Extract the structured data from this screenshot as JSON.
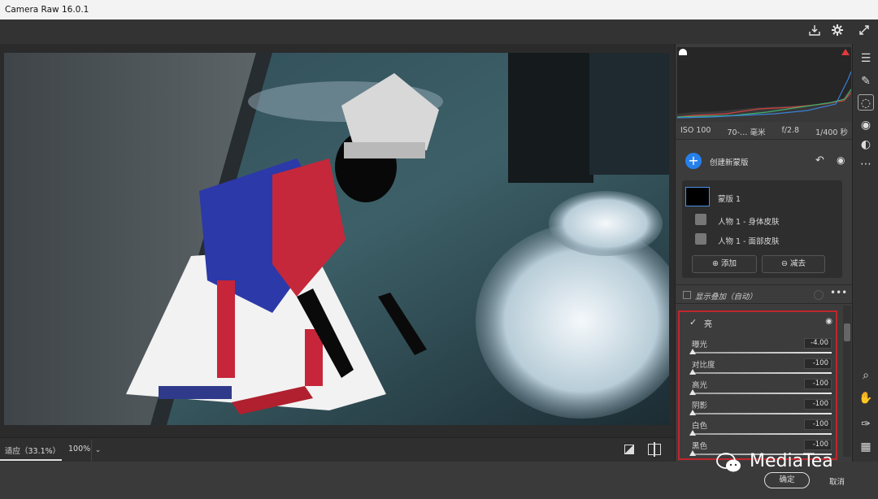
{
  "app": {
    "title": "Camera Raw 16.0.1"
  },
  "exif": {
    "iso": "ISO 100",
    "lens": "70-… 毫米",
    "aperture": "f/2.8",
    "shutter": "1/400 秒"
  },
  "masks": {
    "create_label": "创建新蒙版",
    "mask_name": "蒙版 1",
    "component_1": "人物 1 - 身体皮肤",
    "component_2": "人物 1 - 面部皮肤",
    "add_label": "添加",
    "subtract_label": "减去",
    "overlay_label": "显示叠加（自动）"
  },
  "light": {
    "section_title": "亮",
    "sliders": [
      {
        "label": "曝光",
        "value": "-4.00"
      },
      {
        "label": "对比度",
        "value": "-100"
      },
      {
        "label": "高光",
        "value": "-100"
      },
      {
        "label": "阴影",
        "value": "-100"
      },
      {
        "label": "白色",
        "value": "-100"
      },
      {
        "label": "黑色",
        "value": "-100"
      }
    ]
  },
  "bottom": {
    "fit_label": "适应（33.1%）",
    "zoom_label": "100%"
  },
  "footer": {
    "ok_label": "确定",
    "cancel_label": "取消",
    "watermark": "MediaTea"
  },
  "colors": {
    "accent": "#2680eb",
    "highlight_border": "#c0262d",
    "panel_bg": "#3c3c3c"
  },
  "icons": [
    "save-icon",
    "gear-icon",
    "fullscreen-icon",
    "sliders-icon",
    "brush-icon",
    "mask-icon",
    "redeye-icon",
    "presets-icon",
    "more-icon",
    "zoom-icon",
    "hand-icon",
    "eyedropper-icon",
    "grid-icon"
  ]
}
